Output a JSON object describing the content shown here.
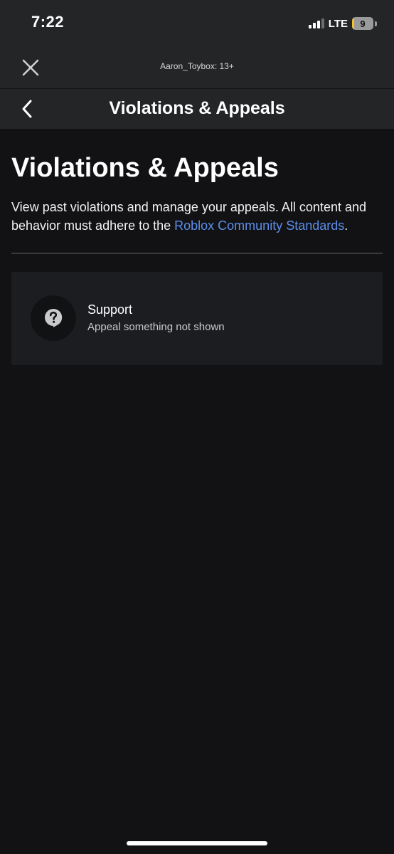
{
  "status_bar": {
    "time": "7:22",
    "network": "LTE",
    "battery_level": "9",
    "battery_fraction": 0.09
  },
  "account_bar": {
    "close_icon": "close-icon",
    "account_label": "Aaron_Toybox: 13+"
  },
  "header": {
    "back_icon": "chevron-left-icon",
    "title": "Violations & Appeals"
  },
  "main": {
    "title": "Violations & Appeals",
    "description_before_link": "View past violations and manage your appeals. All content and behavior must adhere to the ",
    "link_text": "Roblox Community Standards",
    "description_after_link": "."
  },
  "support_item": {
    "icon": "help-chat-icon",
    "title": "Support",
    "subtitle": "Appeal something not shown"
  },
  "colors": {
    "background": "#121215",
    "header": "#232527",
    "card": "#1c1d21",
    "link": "#5c8ee8",
    "battery": "#f3c22b"
  }
}
